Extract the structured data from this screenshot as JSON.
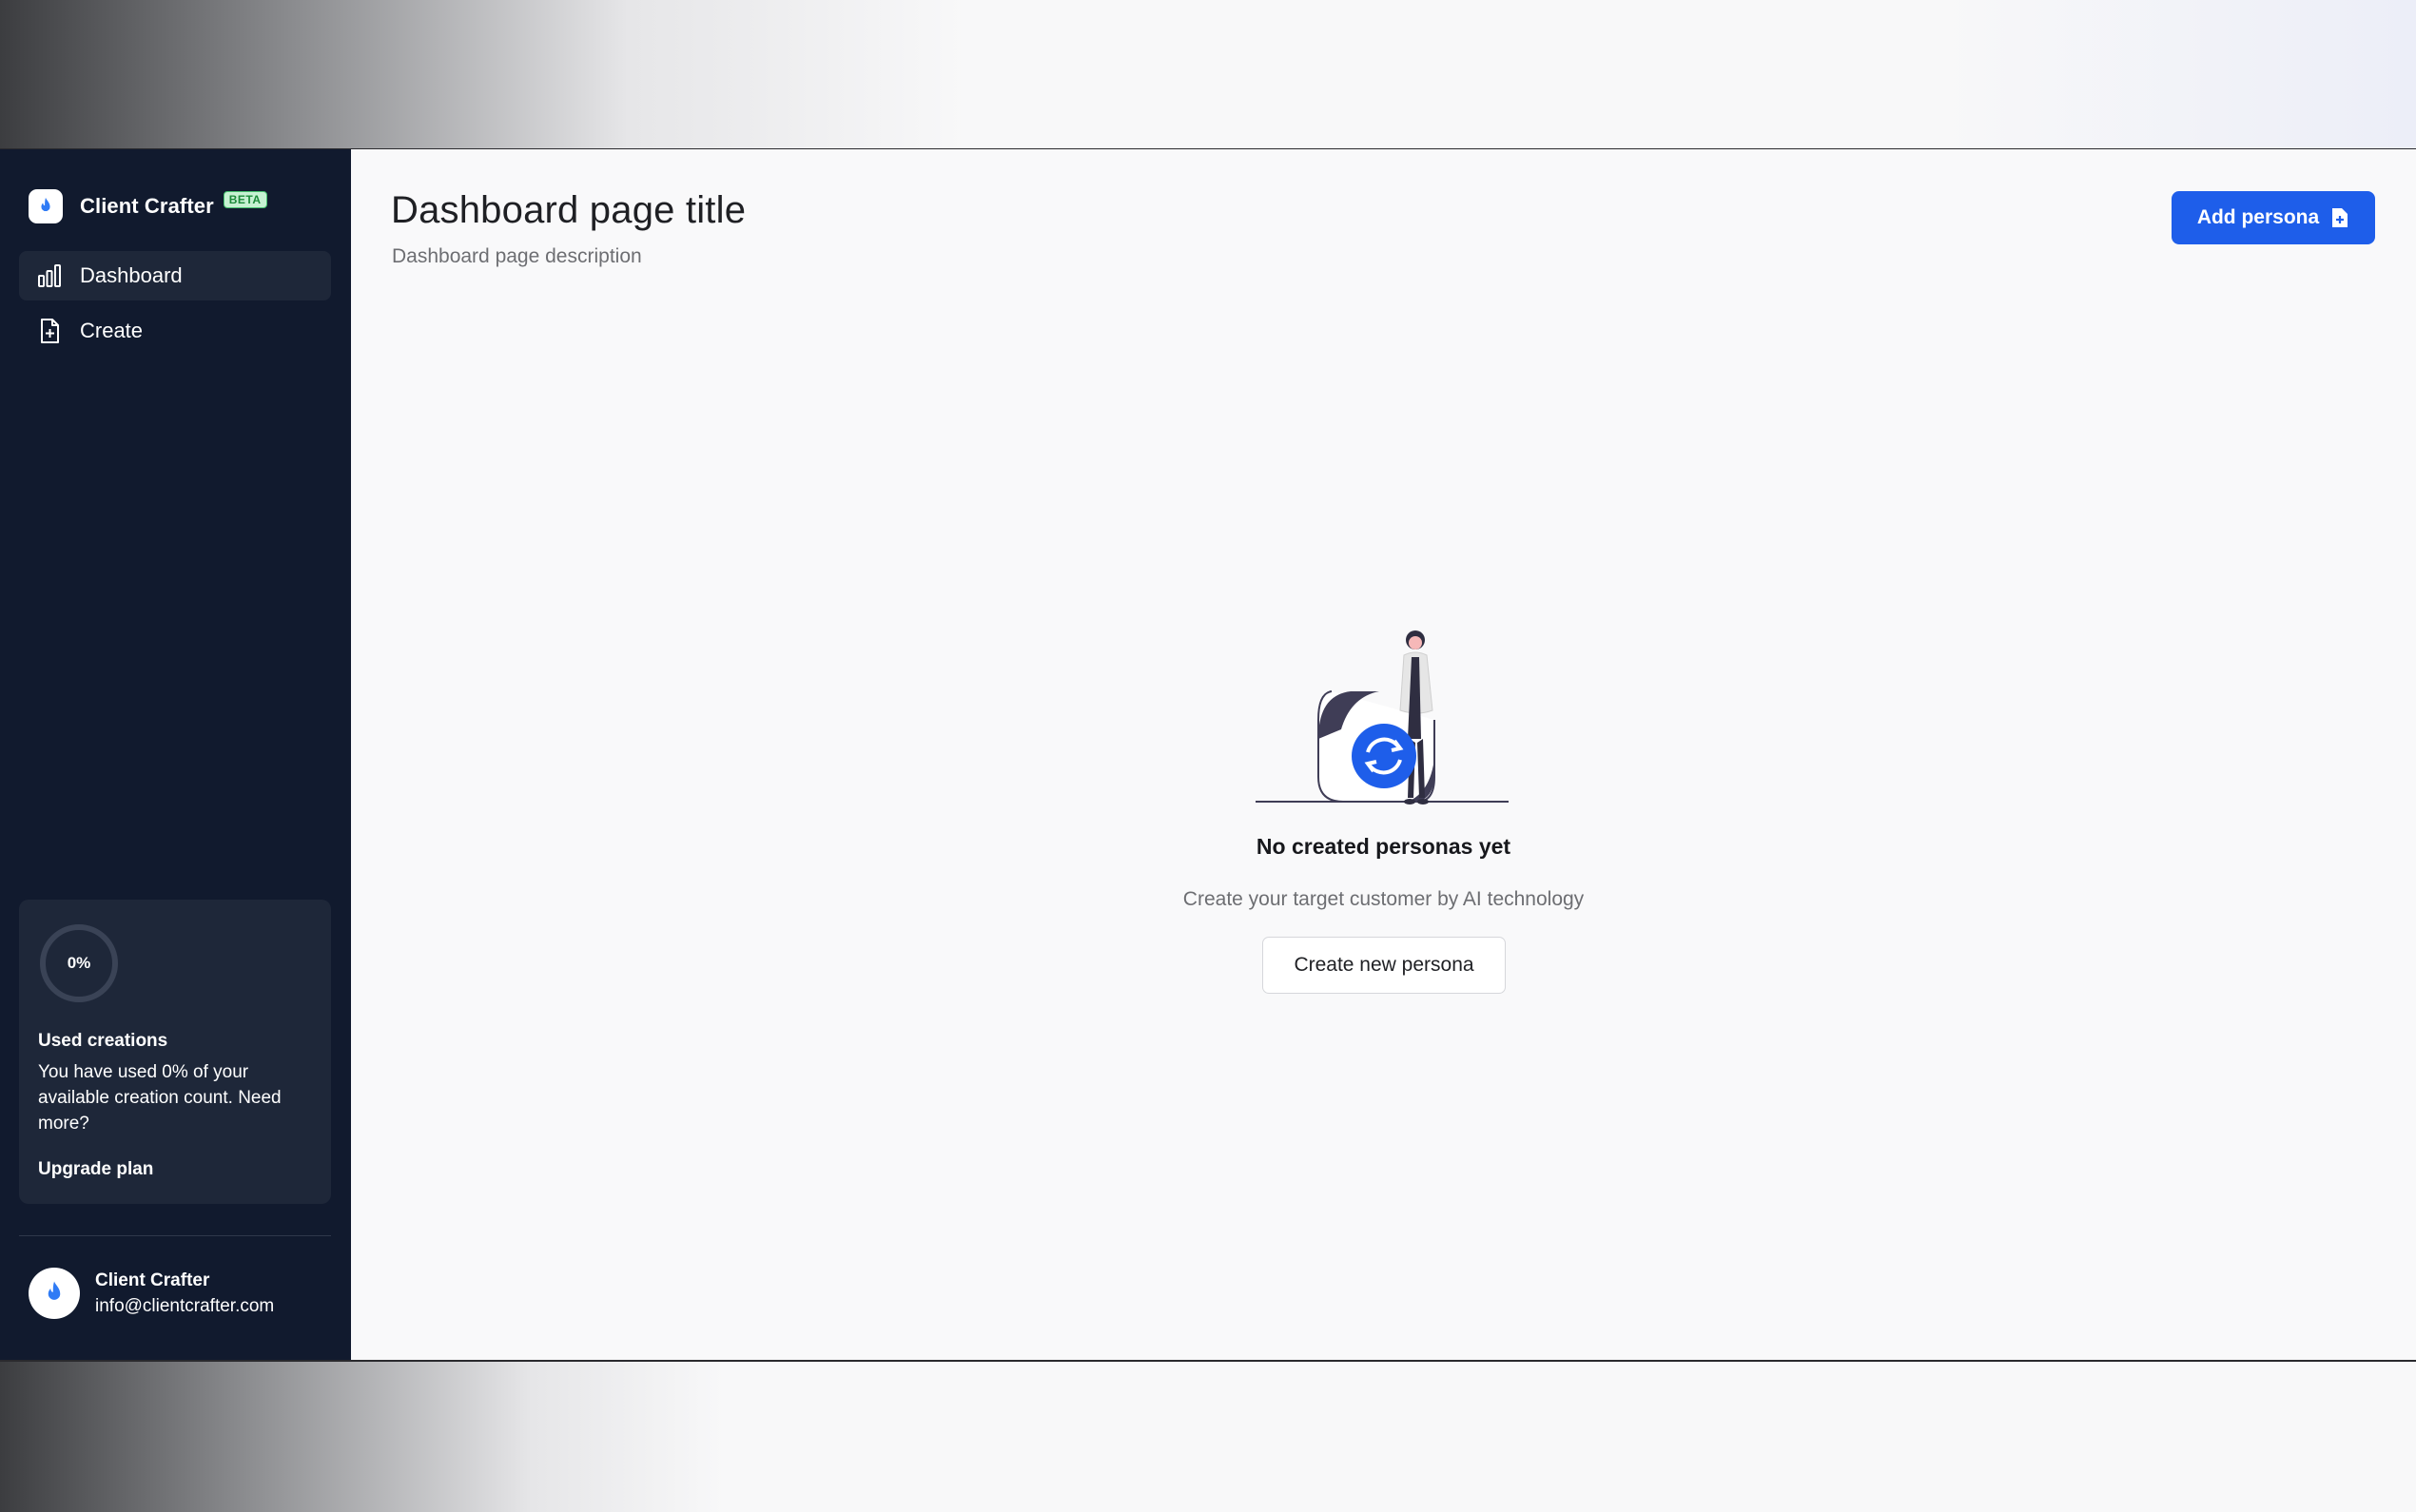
{
  "sidebar": {
    "brand": {
      "name": "Client Crafter",
      "badge": "BETA"
    },
    "items": [
      {
        "label": "Dashboard",
        "icon": "bar-chart-icon",
        "active": true
      },
      {
        "label": "Create",
        "icon": "file-plus-icon",
        "active": false
      }
    ],
    "usage": {
      "percent_label": "0%",
      "percent": 0,
      "title": "Used creations",
      "text": "You have used 0% of your available creation count. Need more?",
      "upgrade_label": "Upgrade plan"
    },
    "user": {
      "name": "Client Crafter",
      "email": "info@clientcrafter.com"
    }
  },
  "main": {
    "title": "Dashboard page title",
    "description": "Dashboard page description",
    "add_button_label": "Add persona",
    "empty_state": {
      "title": "No created personas yet",
      "subtitle": "Create your target customer by AI technology",
      "button_label": "Create new persona"
    }
  },
  "colors": {
    "sidebar_bg": "#111a2e",
    "sidebar_active": "#1e2739",
    "accent": "#1e5eea",
    "badge_bg": "#c6f1d2",
    "badge_text": "#1c8a3a"
  }
}
